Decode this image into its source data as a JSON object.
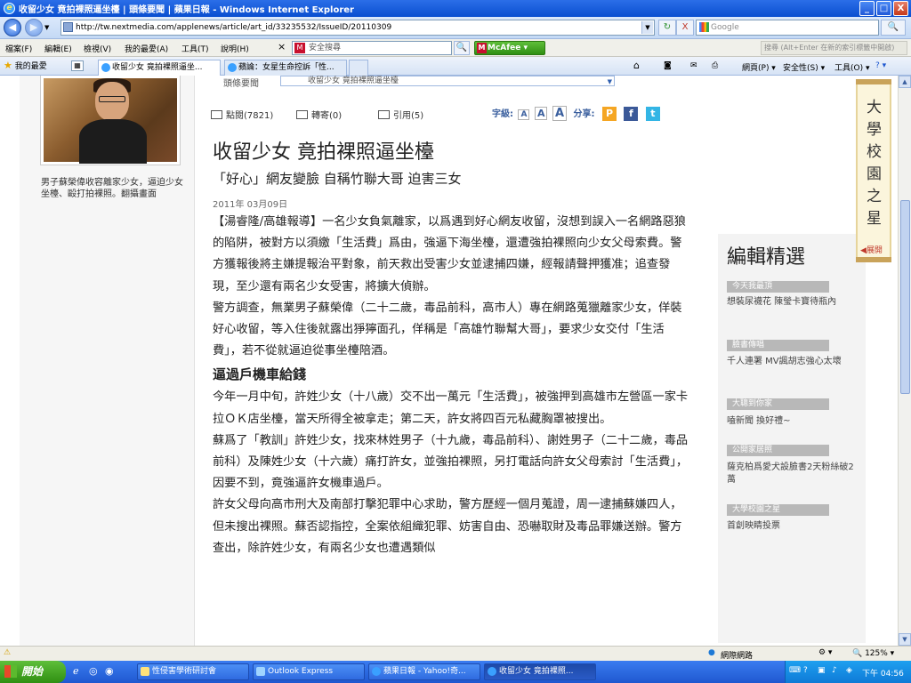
{
  "window": {
    "title": "收留少女 竟拍裸照逼坐檯 | 頭條要聞 | 蘋果日報 - Windows Internet Explorer",
    "buttons": [
      "_",
      "□",
      "X"
    ]
  },
  "address_bar": {
    "back": "◀",
    "forward": "▶",
    "url": "http://tw.nextmedia.com/applenews/article/art_id/33235532/IssueID/20110309",
    "refresh": "↻",
    "stop": "X",
    "search_placeholder": "Google",
    "search_go": "🔍"
  },
  "menu": {
    "items": [
      "檔案(F)",
      "編輯(E)",
      "檢視(V)",
      "我的最愛(A)",
      "工具(T)",
      "說明(H)"
    ],
    "close_x": "×",
    "mcafee_search_placeholder": "安全搜尋",
    "mcafee_label": "McAfee",
    "search_hint": "搜尋 (Alt+Enter 在新的索引標籤中開啟)"
  },
  "tabbar": {
    "favorites_label": "我的最愛",
    "tabs": [
      {
        "label": "收留少女 竟拍裸照逼坐...",
        "active": true
      },
      {
        "label": "蘋論：女星生命控訴「性...",
        "active": false
      }
    ],
    "commands": [
      "網頁(P) ▾",
      "安全性(S) ▾",
      "工具(O) ▾",
      "? ▾"
    ]
  },
  "left": {
    "caption": "男子蘇榮偉收容離家少女，逼迫少女坐檯、毆打拍裸照。翻攝畫面"
  },
  "article": {
    "nav_label": "頭條要聞",
    "nav_select": "收留少女 竟拍裸照逼坐檯",
    "views_label": "點閱(7821)",
    "forward_label": "轉寄(0)",
    "cite_label": "引用(5)",
    "fontsize_label": "字級:",
    "fontsize_options": [
      "A",
      "A",
      "A"
    ],
    "share_label": "分享:",
    "title": "收留少女 竟拍裸照逼坐檯",
    "subtitle": "「好心」網友變臉 自稱竹聯大哥 迫害三女",
    "date": "2011年 03月09日",
    "paragraphs": [
      "【湯睿隆/高雄報導】一名少女負氣離家，以爲遇到好心網友收留，沒想到誤入一名網路惡狼的陷阱，被對方以須繳「生活費」爲由，強逼下海坐檯，還遭強拍裸照向少女父母索費。警方獲報後將主嫌提報治平對象，前天救出受害少女並逮捕四嫌，經報請聲押獲准；追查發現，至少還有兩名少女受害，將擴大偵辦。",
      "警方調查，無業男子蘇榮偉（二十二歲，毒品前科，高市人）專在網路蒐獵離家少女，佯裝好心收留，等入住後就露出猙獰面孔，佯稱是「高雄竹聯幫大哥」，要求少女交付「生活費」，若不從就逼迫從事坐檯陪酒。"
    ],
    "section_heading": "逼過戶機車給錢",
    "paragraphs2": [
      "今年一月中旬，許姓少女（十八歲）交不出一萬元「生活費」，被強押到高雄市左營區一家卡拉ＯＫ店坐檯，當天所得全被拿走；第二天，許女將四百元私藏胸罩被搜出。",
      "蘇爲了「教訓」許姓少女，找來林姓男子（十九歲，毒品前科）、謝姓男子（二十二歲，毒品前科）及陳姓少女（十六歲）痛打許女，並強拍裸照，另打電話向許女父母索討「生活費」，因要不到，竟強逼許女機車過戶。",
      "許女父母向高市刑大及南部打擊犯罪中心求助，警方歷經一個月蒐證，周一逮捕蘇嫌四人，但未搜出裸照。蘇否認指控，全案依組織犯罪、妨害自由、恐嚇取財及毒品罪嫌送辦。警方查出，除許姓少女，有兩名少女也遭遇類似"
    ]
  },
  "sidebar": {
    "banner_text": "大學校園之星",
    "banner_expand": "◀展開",
    "editor_title": "編輯精選",
    "groups": [
      {
        "category": "今天我最頂",
        "text": "想裝尿襪花 陳瑩卡寶待瓶內"
      },
      {
        "category": "臉書傳唱",
        "text": "千人連署 MV諷胡志強心太壞"
      },
      {
        "category": "大聰到你家",
        "text": "嗑新聞 換好禮~"
      },
      {
        "category": "公開家居照",
        "text": "薩克柏爲愛犬設臉書2天粉絲破2萬"
      },
      {
        "category": "大學校園之星",
        "text": "首創映睛投票"
      }
    ]
  },
  "statusbar": {
    "zone": "網際網路",
    "zoom": "125%"
  },
  "taskbar": {
    "start_label": "開始",
    "tasks": [
      {
        "label": "性侵害學術研討會",
        "active": false
      },
      {
        "label": "Outlook Express",
        "active": false
      },
      {
        "label": "蘋果日報 - Yahoo!奇...",
        "active": false
      },
      {
        "label": "收留少女 竟拍裸照...",
        "active": true
      }
    ],
    "clock": "下午 04:56"
  }
}
